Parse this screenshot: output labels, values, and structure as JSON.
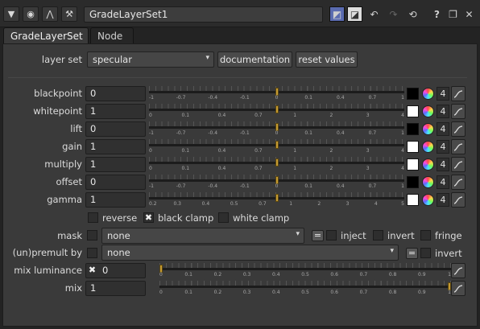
{
  "header": {
    "node_name": "GradeLayerSet1",
    "toolbar_icons": [
      "collapse-triangle-icon",
      "centre-node-icon",
      "input-tree-icon",
      "wrench-icon"
    ],
    "right_icons": [
      "node-color-icon",
      "font-color-icon",
      "undo-icon",
      "redo-icon",
      "revert-icon",
      "help-icon",
      "float-panel-icon",
      "close-icon"
    ]
  },
  "tabs": [
    {
      "label": "GradeLayerSet"
    },
    {
      "label": "Node"
    }
  ],
  "layerset": {
    "label": "layer set",
    "value": "specular",
    "doc_button": "documentation",
    "reset_button": "reset values"
  },
  "params": [
    {
      "label": "blackpoint",
      "value": "0",
      "swatch": "#000000",
      "count": "4",
      "ticks": [
        "-1",
        "-0.7",
        "-0.4",
        "-0.1",
        "0",
        "0.1",
        "0.4",
        "0.7",
        "1"
      ],
      "handle": 0.5
    },
    {
      "label": "whitepoint",
      "value": "1",
      "swatch": "#ffffff",
      "count": "4",
      "ticks": [
        "0",
        "0.1",
        "0.4",
        "0.7",
        "1",
        "2",
        "3",
        "4"
      ],
      "handle": 0.5
    },
    {
      "label": "lift",
      "value": "0",
      "swatch": "#000000",
      "count": "4",
      "ticks": [
        "-1",
        "-0.7",
        "-0.4",
        "-0.1",
        "0",
        "0.1",
        "0.4",
        "0.7",
        "1"
      ],
      "handle": 0.5
    },
    {
      "label": "gain",
      "value": "1",
      "swatch": "#ffffff",
      "count": "4",
      "ticks": [
        "0",
        "0.1",
        "0.4",
        "0.7",
        "1",
        "2",
        "3",
        "4"
      ],
      "handle": 0.5
    },
    {
      "label": "multiply",
      "value": "1",
      "swatch": "#ffffff",
      "count": "4",
      "ticks": [
        "0",
        "0.1",
        "0.4",
        "0.7",
        "1",
        "2",
        "3",
        "4"
      ],
      "handle": 0.5
    },
    {
      "label": "offset",
      "value": "0",
      "swatch": "#000000",
      "count": "4",
      "ticks": [
        "-1",
        "-0.7",
        "-0.4",
        "-0.1",
        "0",
        "0.1",
        "0.4",
        "0.7",
        "1"
      ],
      "handle": 0.5
    },
    {
      "label": "gamma",
      "value": "1",
      "swatch": "#ffffff",
      "count": "4",
      "ticks": [
        "0.2",
        "0.3",
        "0.4",
        "0.5",
        "0.7",
        "1",
        "2",
        "3",
        "4",
        "5"
      ],
      "handle": 0.5
    }
  ],
  "clamps": {
    "reverse": {
      "label": "reverse",
      "checked": false
    },
    "black_clamp": {
      "label": "black clamp",
      "checked": true
    },
    "white_clamp": {
      "label": "white clamp",
      "checked": false
    }
  },
  "mask": {
    "label": "mask",
    "value": "none",
    "inject": "inject",
    "invert": "invert",
    "fringe": "fringe",
    "eq": "="
  },
  "premult": {
    "label": "(un)premult by",
    "value": "none",
    "invert": "invert",
    "eq": "="
  },
  "mix_luminance": {
    "label": "mix luminance",
    "value": "0",
    "checked": true,
    "ticks": [
      "0",
      "0.1",
      "0.2",
      "0.3",
      "0.4",
      "0.5",
      "0.6",
      "0.7",
      "0.8",
      "0.9",
      "1"
    ],
    "handle": 0
  },
  "mix": {
    "label": "mix",
    "value": "1",
    "ticks": [
      "0",
      "0.1",
      "0.2",
      "0.3",
      "0.4",
      "0.5",
      "0.6",
      "0.7",
      "0.8",
      "0.9",
      "1"
    ],
    "handle": 1
  }
}
